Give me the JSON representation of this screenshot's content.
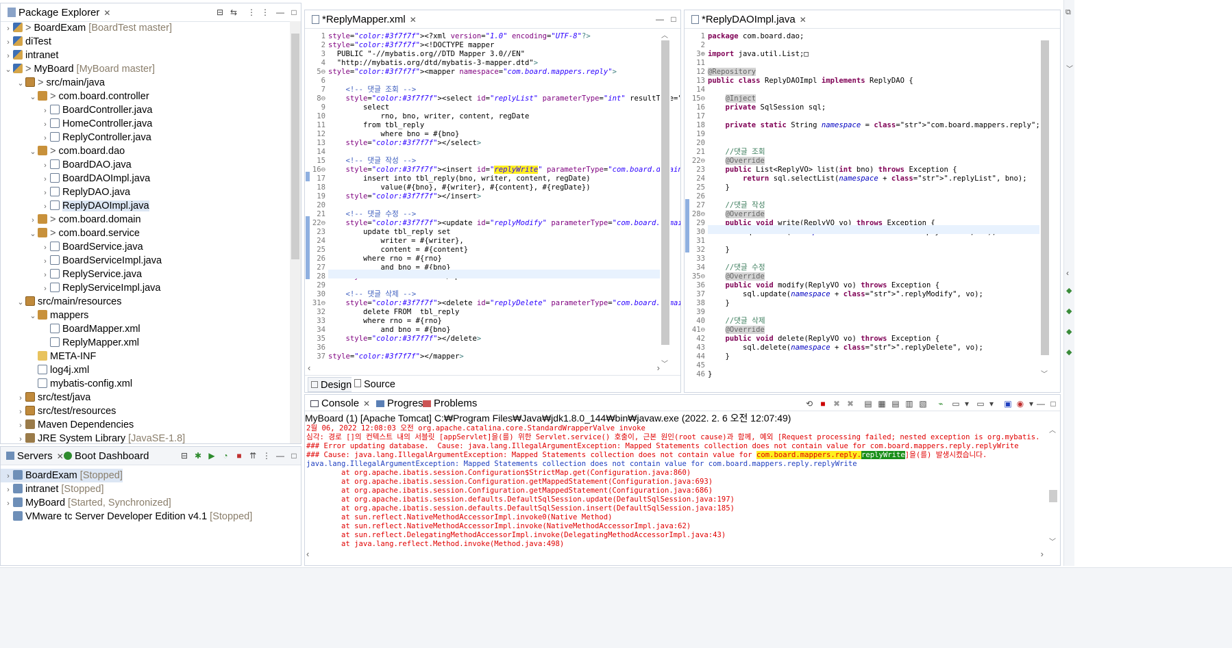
{
  "package_explorer": {
    "title": "Package Explorer",
    "items": [
      {
        "label": "BoardExam",
        "suffix": "[BoardTest master]",
        "icon": "project-icon",
        "prefix": "> "
      },
      {
        "label": "diTest",
        "suffix": "",
        "icon": "project-icon",
        "prefix": ""
      },
      {
        "label": "intranet",
        "suffix": "",
        "icon": "project-icon",
        "prefix": ""
      },
      {
        "label": "MyBoard",
        "suffix": "[MyBoard master]",
        "icon": "project-icon",
        "prefix": "> "
      },
      {
        "label": "src/main/java",
        "suffix": "",
        "icon": "source-folder-icon",
        "prefix": "> "
      },
      {
        "label": "com.board.controller",
        "suffix": "",
        "icon": "package-icon",
        "prefix": "> "
      },
      {
        "label": "BoardController.java",
        "suffix": "",
        "icon": "java-file-icon",
        "prefix": ""
      },
      {
        "label": "HomeController.java",
        "suffix": "",
        "icon": "java-file-icon",
        "prefix": ""
      },
      {
        "label": "ReplyController.java",
        "suffix": "",
        "icon": "java-file-icon",
        "prefix": ""
      },
      {
        "label": "com.board.dao",
        "suffix": "",
        "icon": "package-icon",
        "prefix": "> "
      },
      {
        "label": "BoardDAO.java",
        "suffix": "",
        "icon": "java-file-icon",
        "prefix": ""
      },
      {
        "label": "BoardDAOImpl.java",
        "suffix": "",
        "icon": "java-file-icon",
        "prefix": ""
      },
      {
        "label": "ReplyDAO.java",
        "suffix": "",
        "icon": "java-file-icon",
        "prefix": ""
      },
      {
        "label": "ReplyDAOImpl.java",
        "suffix": "",
        "icon": "java-file-icon",
        "prefix": ""
      },
      {
        "label": "com.board.domain",
        "suffix": "",
        "icon": "package-icon",
        "prefix": "> "
      },
      {
        "label": "com.board.service",
        "suffix": "",
        "icon": "package-icon",
        "prefix": "> "
      },
      {
        "label": "BoardService.java",
        "suffix": "",
        "icon": "java-file-icon",
        "prefix": ""
      },
      {
        "label": "BoardServiceImpl.java",
        "suffix": "",
        "icon": "java-file-icon",
        "prefix": ""
      },
      {
        "label": "ReplyService.java",
        "suffix": "",
        "icon": "java-file-icon",
        "prefix": ""
      },
      {
        "label": "ReplyServiceImpl.java",
        "suffix": "",
        "icon": "java-file-icon",
        "prefix": ""
      },
      {
        "label": "src/main/resources",
        "suffix": "",
        "icon": "source-folder-icon",
        "prefix": ""
      },
      {
        "label": "mappers",
        "suffix": "",
        "icon": "package-icon",
        "prefix": ""
      },
      {
        "label": "BoardMapper.xml",
        "suffix": "",
        "icon": "xml-file-icon",
        "prefix": ""
      },
      {
        "label": "ReplyMapper.xml",
        "suffix": "",
        "icon": "xml-file-icon",
        "prefix": ""
      },
      {
        "label": "META-INF",
        "suffix": "",
        "icon": "folder-icon",
        "prefix": ""
      },
      {
        "label": "log4j.xml",
        "suffix": "",
        "icon": "xml-file-icon",
        "prefix": ""
      },
      {
        "label": "mybatis-config.xml",
        "suffix": "",
        "icon": "xml-file-icon",
        "prefix": ""
      },
      {
        "label": "src/test/java",
        "suffix": "",
        "icon": "source-folder-icon",
        "prefix": ""
      },
      {
        "label": "src/test/resources",
        "suffix": "",
        "icon": "source-folder-icon",
        "prefix": ""
      },
      {
        "label": "Maven Dependencies",
        "suffix": "",
        "icon": "library-icon",
        "prefix": ""
      },
      {
        "label": "JRE System Library",
        "suffix": "[JavaSE-1.8]",
        "icon": "library-icon",
        "prefix": ""
      }
    ]
  },
  "servers": {
    "tab1": "Servers",
    "tab2": "Boot Dashboard",
    "items": [
      {
        "label": "BoardExam",
        "suffix": "[Stopped]"
      },
      {
        "label": "intranet",
        "suffix": "[Stopped]"
      },
      {
        "label": "MyBoard",
        "suffix": "[Started, Synchronized]"
      },
      {
        "label": "VMware tc Server Developer Edition v4.1",
        "suffix": "[Stopped]"
      }
    ]
  },
  "mapper_editor": {
    "tab": "*ReplyMapper.xml",
    "bottom_tabs": [
      "Design",
      "Source"
    ],
    "lines": [
      {
        "n": "1",
        "t": "<?xml version=\"1.0\" encoding=\"UTF-8\"?>"
      },
      {
        "n": "2",
        "t": "<!DOCTYPE mapper"
      },
      {
        "n": "3",
        "t": "  PUBLIC \"-//mybatis.org//DTD Mapper 3.0//EN\""
      },
      {
        "n": "4",
        "t": "  \"http://mybatis.org/dtd/mybatis-3-mapper.dtd\">"
      },
      {
        "n": "5⊖",
        "t": "<mapper namespace=\"com.board.mappers.reply\">"
      },
      {
        "n": "6",
        "t": ""
      },
      {
        "n": "7",
        "t": "    <!-- 댓글 조회 -->"
      },
      {
        "n": "8⊖",
        "t": "    <select id=\"replyList\" parameterType=\"int\" resultType=\"com.board.domain.Repl"
      },
      {
        "n": "9",
        "t": "        select"
      },
      {
        "n": "10",
        "t": "            rno, bno, writer, content, regDate"
      },
      {
        "n": "11",
        "t": "        from tbl_reply"
      },
      {
        "n": "12",
        "t": "            where bno = #{bno}"
      },
      {
        "n": "13",
        "t": "    </select>"
      },
      {
        "n": "14",
        "t": ""
      },
      {
        "n": "15",
        "t": "    <!-- 댓글 작성 -->"
      },
      {
        "n": "16⊖",
        "t": "    <insert id=\"replyWrite\" parameterType=\"com.board.domain.ReplyVO\">"
      },
      {
        "n": "17",
        "t": "        insert into tbl_reply(bno, writer, content, regDate)"
      },
      {
        "n": "18",
        "t": "            value(#{bno}, #{writer}, #{content}, #{regDate})"
      },
      {
        "n": "19",
        "t": "    </insert>"
      },
      {
        "n": "20",
        "t": ""
      },
      {
        "n": "21",
        "t": "    <!-- 댓글 수정 -->"
      },
      {
        "n": "22⊖",
        "t": "    <update id=\"replyModify\" parameterType=\"com.board.domain.ReplyVO\">"
      },
      {
        "n": "23",
        "t": "        update tbl_reply set"
      },
      {
        "n": "24",
        "t": "            writer = #{writer},"
      },
      {
        "n": "25",
        "t": "            content = #{content}"
      },
      {
        "n": "26",
        "t": "        where rno = #{rno}"
      },
      {
        "n": "27",
        "t": "            and bno = #{bno}"
      },
      {
        "n": "28",
        "t": "    </update>"
      },
      {
        "n": "29",
        "t": ""
      },
      {
        "n": "30",
        "t": "    <!-- 댓글 삭제 -->"
      },
      {
        "n": "31⊖",
        "t": "    <delete id=\"replyDelete\" parameterType=\"com.board.domain.ReplyVO\">"
      },
      {
        "n": "32",
        "t": "        delete FROM  tbl_reply"
      },
      {
        "n": "33",
        "t": "        where rno = #{rno}"
      },
      {
        "n": "34",
        "t": "            and bno = #{bno}"
      },
      {
        "n": "35",
        "t": "    </delete>"
      },
      {
        "n": "36",
        "t": ""
      },
      {
        "n": "37",
        "t": "</mapper>"
      }
    ]
  },
  "dao_editor": {
    "tab": "*ReplyDAOImpl.java",
    "lines": [
      {
        "n": "1",
        "t": "package com.board.dao;"
      },
      {
        "n": "2",
        "t": ""
      },
      {
        "n": "3⊕",
        "t": "import java.util.List;□"
      },
      {
        "n": "11",
        "t": ""
      },
      {
        "n": "12",
        "t": "@Repository"
      },
      {
        "n": "13",
        "t": "public class ReplyDAOImpl implements ReplyDAO {"
      },
      {
        "n": "14",
        "t": ""
      },
      {
        "n": "15⊖",
        "t": "    @Inject"
      },
      {
        "n": "16",
        "t": "    private SqlSession sql;"
      },
      {
        "n": "17",
        "t": ""
      },
      {
        "n": "18",
        "t": "    private static String namespace = \"com.board.mappers.reply\";"
      },
      {
        "n": "19",
        "t": ""
      },
      {
        "n": "20",
        "t": ""
      },
      {
        "n": "21",
        "t": "    //댓글 조회"
      },
      {
        "n": "22⊖",
        "t": "    @Override"
      },
      {
        "n": "23",
        "t": "    public List<ReplyVO> list(int bno) throws Exception {"
      },
      {
        "n": "24",
        "t": "        return sql.selectList(namespace + \".replyList\", bno);"
      },
      {
        "n": "25",
        "t": "    }"
      },
      {
        "n": "26",
        "t": ""
      },
      {
        "n": "27",
        "t": "    //댓글 작성"
      },
      {
        "n": "28⊖",
        "t": "    @Override"
      },
      {
        "n": "29",
        "t": "    public void write(ReplyVO vo) throws Exception {"
      },
      {
        "n": "30",
        "t": "        sql.insert(namespace + \".replyWriter\", vo);"
      },
      {
        "n": "31",
        "t": ""
      },
      {
        "n": "32",
        "t": "    }"
      },
      {
        "n": "33",
        "t": ""
      },
      {
        "n": "34",
        "t": "    //댓글 수정"
      },
      {
        "n": "35⊖",
        "t": "    @Override"
      },
      {
        "n": "36",
        "t": "    public void modify(ReplyVO vo) throws Exception {"
      },
      {
        "n": "37",
        "t": "        sql.update(namespace + \".replyModify\", vo);"
      },
      {
        "n": "38",
        "t": "    }"
      },
      {
        "n": "39",
        "t": ""
      },
      {
        "n": "40",
        "t": "    //댓글 삭제"
      },
      {
        "n": "41⊖",
        "t": "    @Override"
      },
      {
        "n": "42",
        "t": "    public void delete(ReplyVO vo) throws Exception {"
      },
      {
        "n": "43",
        "t": "        sql.delete(namespace + \".replyDelete\", vo);"
      },
      {
        "n": "44",
        "t": "    }"
      },
      {
        "n": "45",
        "t": ""
      },
      {
        "n": "46",
        "t": "}"
      }
    ]
  },
  "console": {
    "tabs": [
      "Console",
      "Progress",
      "Problems"
    ],
    "header": "MyBoard (1) [Apache Tomcat] C:₩Program Files₩Java₩jdk1.8.0_144₩bin₩javaw.exe  (2022. 2. 6 오전 12:07:49)",
    "lines": [
      {
        "t": "2월 06, 2022 12:08:03 오전 org.apache.catalina.core.StandardWrapperValve invoke",
        "c": "red"
      },
      {
        "t": "심각: 경로 []의 컨텍스트 내의 서블릿 [appServlet]을(를) 위한 Servlet.service() 호출이, 근본 원인(root cause)과 함께, 예외 [Request processing failed; nested exception is org.mybatis.spring.MyBati",
        "c": "red"
      },
      {
        "t": "### Error updating database.  Cause: java.lang.IllegalArgumentException: Mapped Statements collection does not contain value for com.board.mappers.reply.replyWrite",
        "c": "red"
      },
      {
        "t": "### Cause: java.lang.IllegalArgumentException: Mapped Statements collection does not contain value for com.board.mappers.reply.replyWrite]을(를) 발생시켰습니다.",
        "c": "red"
      },
      {
        "t": "java.lang.IllegalArgumentException: Mapped Statements collection does not contain value for com.board.mappers.reply.replyWrite",
        "c": "blue"
      },
      {
        "t": "\tat org.apache.ibatis.session.Configuration$StrictMap.get(Configuration.java:860)",
        "c": "red"
      },
      {
        "t": "\tat org.apache.ibatis.session.Configuration.getMappedStatement(Configuration.java:693)",
        "c": "red"
      },
      {
        "t": "\tat org.apache.ibatis.session.Configuration.getMappedStatement(Configuration.java:686)",
        "c": "red"
      },
      {
        "t": "\tat org.apache.ibatis.session.defaults.DefaultSqlSession.update(DefaultSqlSession.java:197)",
        "c": "red"
      },
      {
        "t": "\tat org.apache.ibatis.session.defaults.DefaultSqlSession.insert(DefaultSqlSession.java:185)",
        "c": "red"
      },
      {
        "t": "\tat sun.reflect.NativeMethodAccessorImpl.invoke0(Native Method)",
        "c": "red"
      },
      {
        "t": "\tat sun.reflect.NativeMethodAccessorImpl.invoke(NativeMethodAccessorImpl.java:62)",
        "c": "red"
      },
      {
        "t": "\tat sun.reflect.DelegatingMethodAccessorImpl.invoke(DelegatingMethodAccessorImpl.java:43)",
        "c": "red"
      },
      {
        "t": "\tat java.lang.reflect.Method.invoke(Method.java:498)",
        "c": "red"
      }
    ]
  },
  "colors": {
    "keyword": "#7f0055",
    "string": "#2a00ff",
    "comment": "#3f5fbf",
    "error": "#e00000",
    "highlight": "#ffef20",
    "console_link": "#2040c0"
  }
}
